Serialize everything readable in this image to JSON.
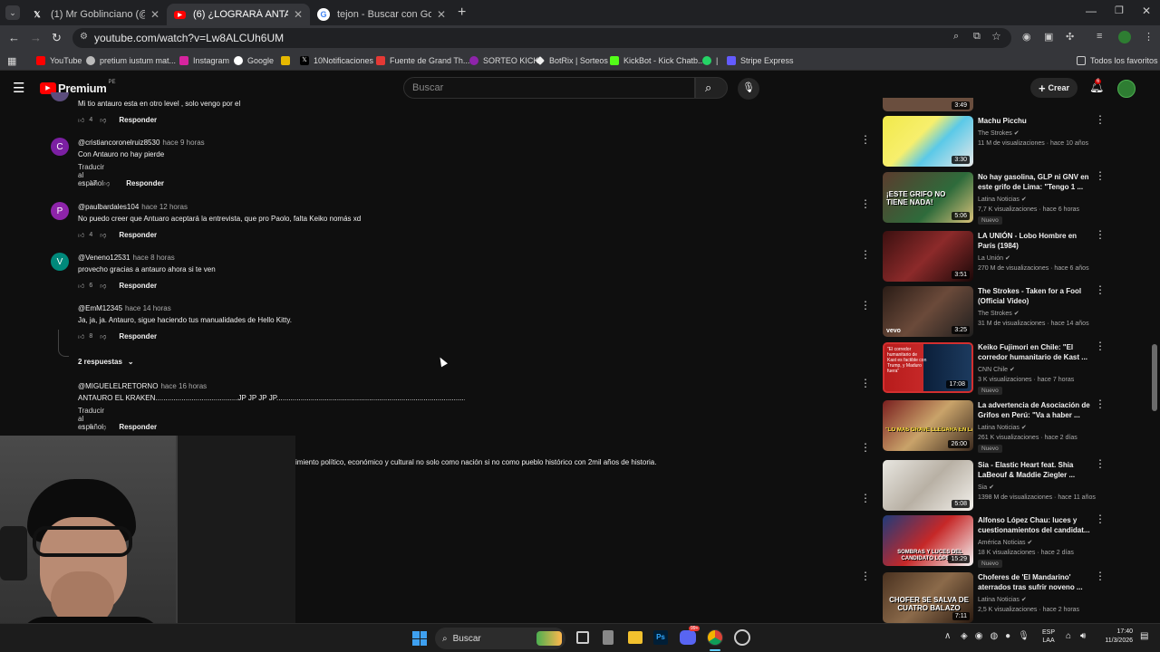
{
  "browser": {
    "tabs": [
      {
        "title": "(1) Mr Goblinciano (@MGoblinc",
        "icon": "x-icon",
        "active": false
      },
      {
        "title": "(6) ¿LOGRARÁ ANTAURO HUM",
        "icon": "youtube-icon",
        "active": true
      },
      {
        "title": "tejon - Buscar con Google",
        "icon": "google-icon",
        "active": false
      }
    ],
    "url": "youtube.com/watch?v=Lw8ALCUh6UM",
    "bookmarks": [
      "YouTube",
      "pretium iustum mat...",
      "Instagram",
      "Google",
      "",
      "10Notificaciones",
      "Fuente de Grand Th...",
      "SORTEO KICK",
      "BotRix | Sorteos",
      "KickBot - Kick Chatb...",
      "|",
      "Stripe Express"
    ],
    "all_bookmarks": "Todos los favoritos"
  },
  "yt": {
    "logo": "Premium",
    "logo_suffix": "PE",
    "search_placeholder": "Buscar",
    "create": "Crear",
    "notif_count": "6"
  },
  "comments": [
    {
      "text": "Mi tio antauro esta en otro level , solo vengo por el",
      "likes": "4",
      "reply": "Responder"
    },
    {
      "user": "@cristiancoronelruiz8530",
      "time": "hace 9 horas",
      "text": "Con Antauro no hay pierde",
      "translate": "Traducir al español",
      "likes": "13",
      "reply": "Responder",
      "avatar": "C",
      "color": "#7b1fa2"
    },
    {
      "user": "@paulbardales104",
      "time": "hace 12 horas",
      "text": "No puedo creer que Antuaro aceptará la entrevista, que pro Paolo, falta Keiko nomás xd",
      "likes": "4",
      "reply": "Responder",
      "avatar": "P",
      "color": "#8e24aa"
    },
    {
      "user": "@Veneno12531",
      "time": "hace 8 horas",
      "text": "provecho gracias a antauro ahora si te ven",
      "likes": "6",
      "reply": "Responder",
      "avatar": "V",
      "color": "#00897b"
    },
    {
      "user": "@EmM12345",
      "time": "hace 14 horas",
      "text": "Ja, ja, ja. Antauro, sigue haciendo tus manualidades de Hello Kitty.",
      "likes": "8",
      "reply": "Responder"
    },
    {
      "user": "@MIGUELELRETORNO",
      "time": "hace 16 horas",
      "text": "ANTAURO EL KRAKEN.........................................JP JP JP JP...............................................................................................................",
      "translate": "Traducir al español",
      "likes": "6",
      "reply": "Responder"
    }
  ],
  "replies_toggle": "2 respuestas",
  "partial_comment": "imiento político, económico y cultural no solo como nación si no como pueblo histórico con 2mil años de historia.",
  "recommendations": [
    {
      "title": "Machu Picchu",
      "channel": "The Strokes",
      "meta": "11 M de visualizaciones · hace 10 años",
      "duration": "3:30",
      "badge": ""
    },
    {
      "title": "No hay gasolina, GLP ni GNV en este grifo de Lima: \"Tengo 1 ...",
      "channel": "Latina Noticias",
      "meta": "7,7 K visualizaciones · hace 6 horas",
      "duration": "5:06",
      "badge": "Nuevo",
      "thumb_text": "¡ESTE GRIFO NO TIENE NADA!"
    },
    {
      "title": "LA UNIÓN - Lobo Hombre en París (1984)",
      "channel": "La Unión",
      "meta": "270 M de visualizaciones · hace 6 años",
      "duration": "3:51",
      "badge": ""
    },
    {
      "title": "The Strokes - Taken for a Fool (Official Video)",
      "channel": "The Strokes",
      "meta": "31 M de visualizaciones · hace 14 años",
      "duration": "3:25",
      "badge": "",
      "thumb_text": "vevo"
    },
    {
      "title": "Keiko Fujimori en Chile: \"El corredor humanitario de Kast ...",
      "channel": "CNN Chile",
      "meta": "3 K visualizaciones · hace 7 horas",
      "duration": "17:08",
      "badge": "Nuevo",
      "thumb_text": "\"El corredor humanitario de Kast es factible con Trump, y Maduro fuera\""
    },
    {
      "title": "La advertencia de Asociación de Grifos en Perú: \"Va a haber ...",
      "channel": "Latina Noticias",
      "meta": "261 K visualizaciones · hace 2 días",
      "duration": "26:00",
      "badge": "Nuevo",
      "thumb_text": "\"LO MAS GRAVE LLEGARA EN LAS PRÓXIMAS SEM"
    },
    {
      "title": "Sia - Elastic Heart feat. Shia LaBeouf & Maddie Ziegler ...",
      "channel": "Sia",
      "meta": "1398 M de visualizaciones · hace 11 años",
      "duration": "5:08",
      "badge": ""
    },
    {
      "title": "Alfonso López Chau: luces y cuestionamientos del candidat...",
      "channel": "América Noticias",
      "meta": "18 K visualizaciones · hace 2 días",
      "duration": "15:29",
      "badge": "Nuevo",
      "thumb_text": "SOMBRAS Y LUCES DEL CANDIDATO LÓPEZ C"
    },
    {
      "title": "Choferes de 'El Mandarino' aterrados tras sufrir noveno ...",
      "channel": "Latina Noticias",
      "meta": "2,5 K visualizaciones · hace 2 horas",
      "duration": "7:11",
      "badge": "",
      "thumb_text": "CHOFER SE SALVA DE CUATRO BALAZO"
    }
  ],
  "top_partial_duration": "3:49",
  "taskbar": {
    "search": "Buscar",
    "lang": "ESP",
    "lang2": "LAA",
    "time": "17:40",
    "date": "11/3/2026",
    "chrome_badge": "99+"
  }
}
